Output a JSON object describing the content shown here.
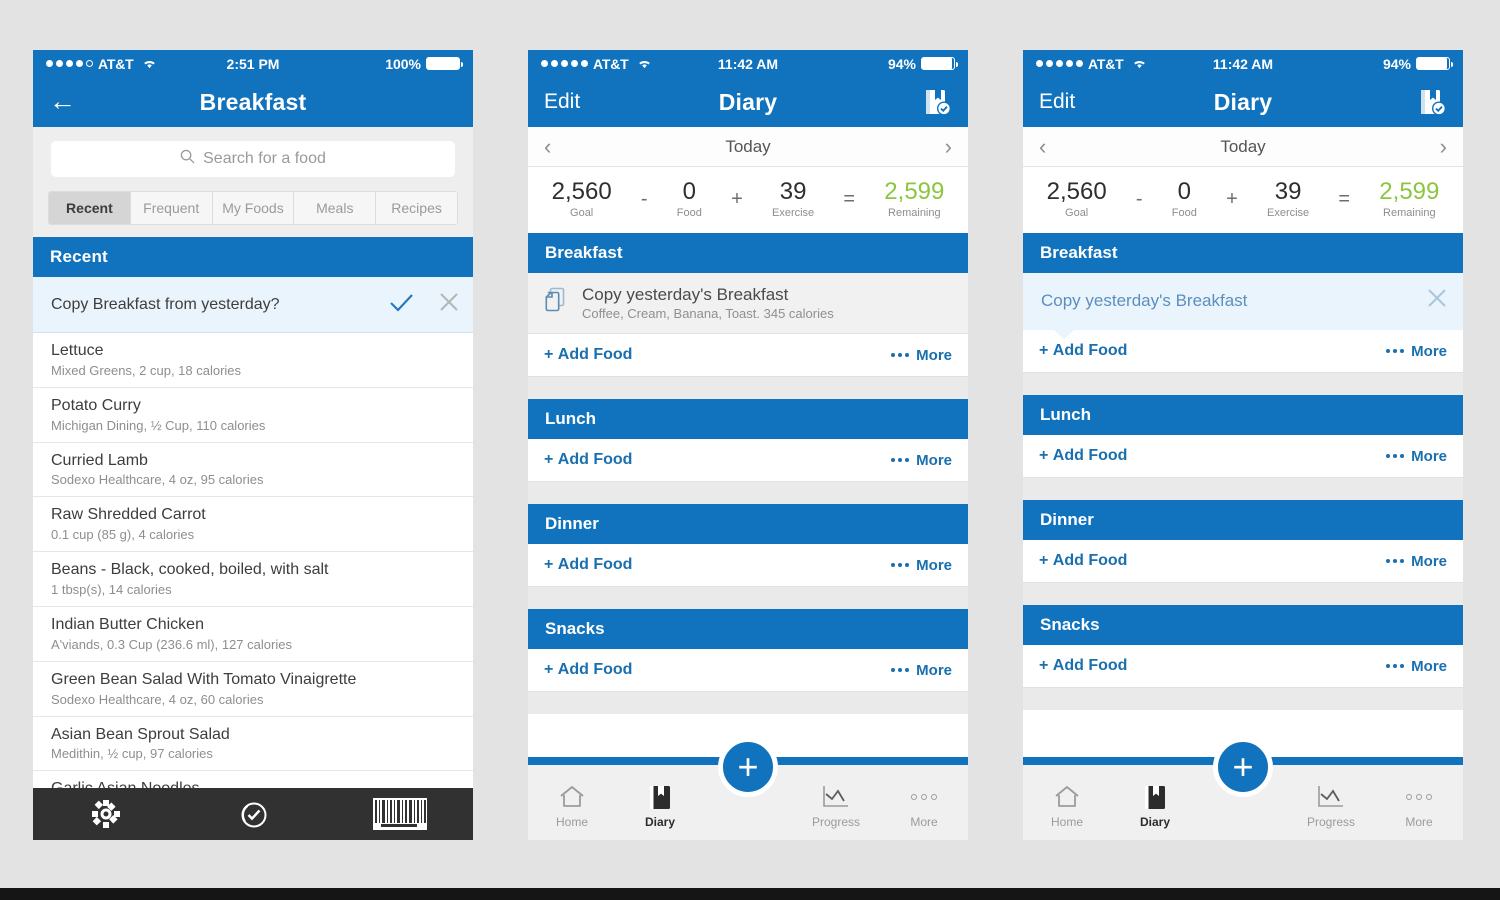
{
  "phone1": {
    "status": {
      "carrier": "AT&T",
      "signal_filled": 4,
      "signal_total": 5,
      "time": "2:51 PM",
      "battery": "100%",
      "battery_pct": 100
    },
    "nav": {
      "back_icon": "back-arrow-icon",
      "title": "Breakfast"
    },
    "search": {
      "placeholder": "Search for a food",
      "icon": "search-icon"
    },
    "tabs": [
      {
        "label": "Recent",
        "active": true
      },
      {
        "label": "Frequent",
        "active": false
      },
      {
        "label": "My Foods",
        "active": false
      },
      {
        "label": "Meals",
        "active": false
      },
      {
        "label": "Recipes",
        "active": false
      }
    ],
    "section_header": "Recent",
    "copy_prompt": {
      "label": "Copy Breakfast from yesterday?",
      "accept_icon": "checkmark-icon",
      "dismiss_icon": "close-icon"
    },
    "foods": [
      {
        "name": "Lettuce",
        "desc": "Mixed Greens, 2 cup, 18 calories"
      },
      {
        "name": "Potato Curry",
        "desc": "Michigan Dining, ½ Cup, 110 calories"
      },
      {
        "name": "Curried Lamb",
        "desc": "Sodexo Healthcare, 4 oz, 95 calories"
      },
      {
        "name": "Raw Shredded Carrot",
        "desc": "0.1 cup (85 g), 4 calories"
      },
      {
        "name": "Beans - Black, cooked, boiled, with salt",
        "desc": "1 tbsp(s), 14 calories"
      },
      {
        "name": "Indian Butter Chicken",
        "desc": "A'viands, 0.3 Cup (236.6 ml), 127 calories"
      },
      {
        "name": "Green Bean Salad With Tomato Vinaigrette",
        "desc": "Sodexo Healthcare, 4 oz, 60 calories"
      },
      {
        "name": "Asian Bean Sprout Salad",
        "desc": "Medithin, ½ cup, 97 calories"
      }
    ],
    "clipped_food": {
      "name": "Garlic Asian Noodles"
    },
    "toolbar": [
      {
        "icon": "gear-icon"
      },
      {
        "icon": "check-circle-icon"
      },
      {
        "icon": "barcode-icon"
      }
    ]
  },
  "phone2": {
    "status": {
      "carrier": "AT&T",
      "signal_filled": 5,
      "signal_total": 5,
      "time": "11:42 AM",
      "battery": "94%",
      "battery_pct": 94
    },
    "nav": {
      "left_label": "Edit",
      "title": "Diary",
      "right_icon": "save-diary-icon"
    },
    "daynav": {
      "prev_icon": "chevron-left-icon",
      "label": "Today",
      "next_icon": "chevron-right-icon"
    },
    "stats": {
      "goal_value": "2,560",
      "goal_label": "Goal",
      "op1": "-",
      "food_value": "0",
      "food_label": "Food",
      "op2": "+",
      "exercise_value": "39",
      "exercise_label": "Exercise",
      "op3": "=",
      "remaining_value": "2,599",
      "remaining_label": "Remaining",
      "remaining_color": "#8cc63f"
    },
    "meals": [
      {
        "name": "Breakfast",
        "add_label": "Add Food",
        "more_label": "More"
      },
      {
        "name": "Lunch",
        "add_label": "Add Food",
        "more_label": "More"
      },
      {
        "name": "Dinner",
        "add_label": "Add Food",
        "more_label": "More"
      },
      {
        "name": "Snacks",
        "add_label": "Add Food",
        "more_label": "More"
      }
    ],
    "copy_suggestion": {
      "icon": "copy-icon",
      "title": "Copy yesterday's Breakfast",
      "subtitle": "Coffee, Cream, Banana, Toast. 345 calories"
    },
    "tabbar": [
      {
        "label": "Home",
        "icon": "home-icon",
        "active": false
      },
      {
        "label": "Diary",
        "icon": "book-icon",
        "active": true
      },
      {
        "label": "Progress",
        "icon": "chart-line-icon",
        "active": false
      },
      {
        "label": "More",
        "icon": "ellipsis-icon",
        "active": false
      }
    ],
    "fab": {
      "icon": "plus-icon",
      "label": "+"
    }
  },
  "phone3": {
    "status": {
      "carrier": "AT&T",
      "signal_filled": 5,
      "signal_total": 5,
      "time": "11:42 AM",
      "battery": "94%",
      "battery_pct": 94
    },
    "nav": {
      "left_label": "Edit",
      "title": "Diary",
      "right_icon": "save-diary-icon"
    },
    "daynav": {
      "prev_icon": "chevron-left-icon",
      "label": "Today",
      "next_icon": "chevron-right-icon"
    },
    "stats": {
      "goal_value": "2,560",
      "goal_label": "Goal",
      "op1": "-",
      "food_value": "0",
      "food_label": "Food",
      "op2": "+",
      "exercise_value": "39",
      "exercise_label": "Exercise",
      "op3": "=",
      "remaining_value": "2,599",
      "remaining_label": "Remaining",
      "remaining_color": "#8cc63f"
    },
    "meals": [
      {
        "name": "Breakfast",
        "add_label": "Add Food",
        "more_label": "More"
      },
      {
        "name": "Lunch",
        "add_label": "Add Food",
        "more_label": "More"
      },
      {
        "name": "Dinner",
        "add_label": "Add Food",
        "more_label": "More"
      },
      {
        "name": "Snacks",
        "add_label": "Add Food",
        "more_label": "More"
      }
    ],
    "tooltip": {
      "text": "Copy yesterday's Breakfast",
      "dismiss_icon": "close-icon"
    },
    "tabbar": [
      {
        "label": "Home",
        "icon": "home-icon",
        "active": false
      },
      {
        "label": "Diary",
        "icon": "book-icon",
        "active": true
      },
      {
        "label": "Progress",
        "icon": "chart-line-icon",
        "active": false
      },
      {
        "label": "More",
        "icon": "ellipsis-icon",
        "active": false
      }
    ],
    "fab": {
      "icon": "plus-icon",
      "label": "+"
    }
  },
  "theme": {
    "accent_blue": "#1173bd",
    "link_blue": "#1a6fae",
    "green": "#8cc63f",
    "page_bg": "#e3e3e3",
    "dark_toolbar": "#313131"
  }
}
